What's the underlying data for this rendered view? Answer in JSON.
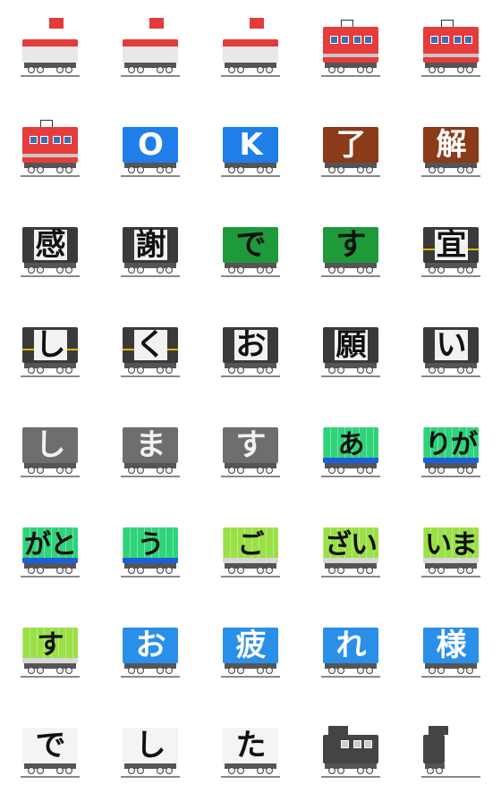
{
  "stickers": [
    {
      "type": "loco-de",
      "text": "",
      "body": "#e8e8e8",
      "accent": "#e33a3a",
      "icon": "diesel-locomotive-icon"
    },
    {
      "type": "loco-de",
      "text": "",
      "body": "#e8e8e8",
      "accent": "#e33a3a",
      "icon": "diesel-locomotive-icon"
    },
    {
      "type": "loco-de",
      "text": "",
      "body": "#e8e8e8",
      "accent": "#e33a3a",
      "icon": "diesel-locomotive-icon"
    },
    {
      "type": "loco-el",
      "text": "",
      "body": "#e63c3c",
      "accent": "#c8c8c8",
      "icon": "electric-locomotive-icon"
    },
    {
      "type": "loco-el",
      "text": "",
      "body": "#e63c3c",
      "accent": "#c8c8c8",
      "icon": "electric-locomotive-icon"
    },
    {
      "type": "loco-el",
      "text": "",
      "body": "#e63c3c",
      "accent": "#c8c8c8",
      "icon": "electric-locomotive-icon"
    },
    {
      "type": "box",
      "text": "O",
      "body": "#1f7fe8",
      "accent": "#ffffff",
      "icon": "blue-boxcar-icon"
    },
    {
      "type": "box",
      "text": "K",
      "body": "#1f7fe8",
      "accent": "#ffffff",
      "icon": "blue-boxcar-icon"
    },
    {
      "type": "box",
      "text": "了",
      "body": "#8b3a1a",
      "accent": "#ffffff",
      "icon": "brown-boxcar-icon"
    },
    {
      "type": "box",
      "text": "解",
      "body": "#8b3a1a",
      "accent": "#ffffff",
      "icon": "brown-boxcar-icon"
    },
    {
      "type": "box",
      "text": "感",
      "body": "#3a3a3a",
      "accent": "#ffffff",
      "icon": "gray-boxcar-icon"
    },
    {
      "type": "box",
      "text": "謝",
      "body": "#3a3a3a",
      "accent": "#ffffff",
      "icon": "gray-boxcar-icon"
    },
    {
      "type": "box",
      "text": "で",
      "body": "#1e9a3a",
      "accent": "#ffffff",
      "icon": "green-boxcar-icon"
    },
    {
      "type": "box",
      "text": "す",
      "body": "#1e9a3a",
      "accent": "#ffffff",
      "icon": "green-boxcar-icon"
    },
    {
      "type": "stripe",
      "text": "宜",
      "body": "#3a3a3a",
      "accent": "#e0b400",
      "icon": "striped-wagon-icon"
    },
    {
      "type": "stripe",
      "text": "し",
      "body": "#3a3a3a",
      "accent": "#e0b400",
      "icon": "striped-wagon-icon"
    },
    {
      "type": "stripe",
      "text": "く",
      "body": "#3a3a3a",
      "accent": "#e0b400",
      "icon": "striped-wagon-icon"
    },
    {
      "type": "box",
      "text": "お",
      "body": "#3a3a3a",
      "accent": "#ffffff",
      "icon": "gray-boxcar-icon"
    },
    {
      "type": "box",
      "text": "願",
      "body": "#3a3a3a",
      "accent": "#ffffff",
      "icon": "gray-boxcar-icon"
    },
    {
      "type": "box",
      "text": "い",
      "body": "#3a3a3a",
      "accent": "#ffffff",
      "icon": "gray-boxcar-icon"
    },
    {
      "type": "box",
      "text": "し",
      "body": "#6e6e6e",
      "accent": "#ffffff",
      "icon": "gray-boxcar-icon"
    },
    {
      "type": "box",
      "text": "ま",
      "body": "#6e6e6e",
      "accent": "#ffffff",
      "icon": "gray-boxcar-icon"
    },
    {
      "type": "box",
      "text": "す",
      "body": "#6e6e6e",
      "accent": "#ffffff",
      "icon": "gray-boxcar-icon"
    },
    {
      "type": "container",
      "text": "あ",
      "body": "#2ed37a",
      "accent": "#1b5fe0",
      "icon": "container-wagon-icon"
    },
    {
      "type": "container",
      "text": "りが",
      "body": "#2ed37a",
      "accent": "#1b5fe0",
      "icon": "container-wagon-icon"
    },
    {
      "type": "container",
      "text": "がと",
      "body": "#2ed37a",
      "accent": "#1b5fe0",
      "icon": "container-wagon-icon"
    },
    {
      "type": "container",
      "text": "う",
      "body": "#2ed37a",
      "accent": "#1b5fe0",
      "icon": "container-wagon-icon"
    },
    {
      "type": "container",
      "text": "ご",
      "body": "#9ae046",
      "accent": "#d8d8d8",
      "icon": "container-wagon-icon"
    },
    {
      "type": "container",
      "text": "ざい",
      "body": "#9ae046",
      "accent": "#d8d8d8",
      "icon": "container-wagon-icon"
    },
    {
      "type": "container",
      "text": "いま",
      "body": "#9ae046",
      "accent": "#d8d8d8",
      "icon": "container-wagon-icon"
    },
    {
      "type": "container",
      "text": "す",
      "body": "#9ae046",
      "accent": "#d8d8d8",
      "icon": "container-wagon-icon"
    },
    {
      "type": "box",
      "text": "お",
      "body": "#2a8fe8",
      "accent": "#ffffff",
      "icon": "blue-boxcar-icon"
    },
    {
      "type": "box",
      "text": "疲",
      "body": "#2a8fe8",
      "accent": "#ffffff",
      "icon": "blue-boxcar-icon"
    },
    {
      "type": "box",
      "text": "れ",
      "body": "#2a8fe8",
      "accent": "#ffffff",
      "icon": "blue-boxcar-icon"
    },
    {
      "type": "box",
      "text": "様",
      "body": "#2a8fe8",
      "accent": "#ffffff",
      "icon": "blue-boxcar-icon"
    },
    {
      "type": "box",
      "text": "で",
      "body": "#f4f4f4",
      "accent": "#999999",
      "icon": "white-refrigerator-car-icon"
    },
    {
      "type": "box",
      "text": "し",
      "body": "#f4f4f4",
      "accent": "#999999",
      "icon": "white-refrigerator-car-icon"
    },
    {
      "type": "box",
      "text": "た",
      "body": "#f4f4f4",
      "accent": "#999999",
      "icon": "white-refrigerator-car-icon"
    },
    {
      "type": "caboose",
      "text": "",
      "body": "#444444",
      "accent": "#cccccc",
      "icon": "caboose-icon"
    },
    {
      "type": "caboose-end",
      "text": "",
      "body": "#444444",
      "accent": "#cccccc",
      "icon": "caboose-end-icon"
    }
  ]
}
